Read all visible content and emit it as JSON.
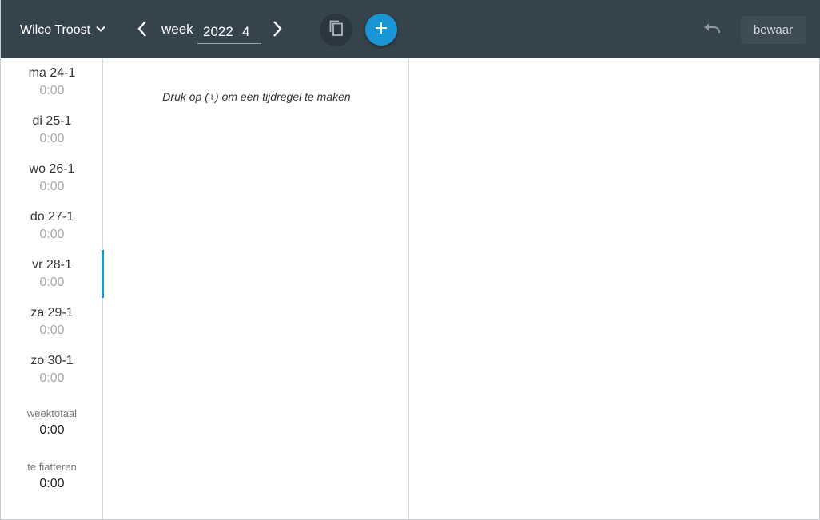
{
  "header": {
    "user_name": "Wilco Troost",
    "week_label": "week",
    "year": "2022",
    "week_number": "4",
    "save_label": "bewaar"
  },
  "days": [
    {
      "label": "ma 24-1",
      "hours": "0:00"
    },
    {
      "label": "di 25-1",
      "hours": "0:00"
    },
    {
      "label": "wo 26-1",
      "hours": "0:00"
    },
    {
      "label": "do 27-1",
      "hours": "0:00"
    },
    {
      "label": "vr 28-1",
      "hours": "0:00",
      "active": true
    },
    {
      "label": "za 29-1",
      "hours": "0:00"
    },
    {
      "label": "zo 30-1",
      "hours": "0:00"
    }
  ],
  "summary": {
    "week_total_label": "weektotaal",
    "week_total_value": "0:00",
    "to_approve_label": "te fiatteren",
    "to_approve_value": "0:00"
  },
  "main": {
    "hint": "Druk op (+) om een tijdregel te maken"
  },
  "icons": {
    "user_menu": "chevron-down-icon",
    "prev": "chevron-left-icon",
    "next": "chevron-right-icon",
    "copy": "copy-icon",
    "add": "plus-icon",
    "undo": "undo-icon"
  },
  "colors": {
    "topbar": "#35434d",
    "accent": "#1a96d4",
    "save_button": "#3e4c56",
    "muted_text": "#a9a9a9"
  }
}
